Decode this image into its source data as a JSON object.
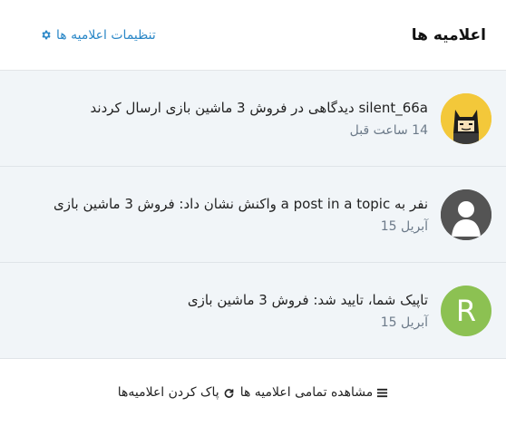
{
  "header": {
    "title": "اعلامیه ها",
    "settings_label": "تنظیمات اعلامیه ها"
  },
  "notifications": [
    {
      "text": "silent_66a دیدگاهی در فروش 3 ماشین بازی ارسال کردند",
      "time": "14 ساعت قبل"
    },
    {
      "text": "نفر به a post in a topic واکنش نشان داد: فروش 3 ماشین بازی",
      "time": "آبریل 15"
    },
    {
      "avatar_letter": "R",
      "text": "تاپیک شما، تایید شد: فروش 3 ماشین بازی",
      "time": "آبریل 15"
    }
  ],
  "footer": {
    "view_all_label": "مشاهده تمامی اعلامیه ها",
    "clear_label": "پاک کردن اعلامیه‌ها"
  },
  "colors": {
    "accent": "#2a87c7",
    "avatar_letter_bg": "#8cc152"
  }
}
